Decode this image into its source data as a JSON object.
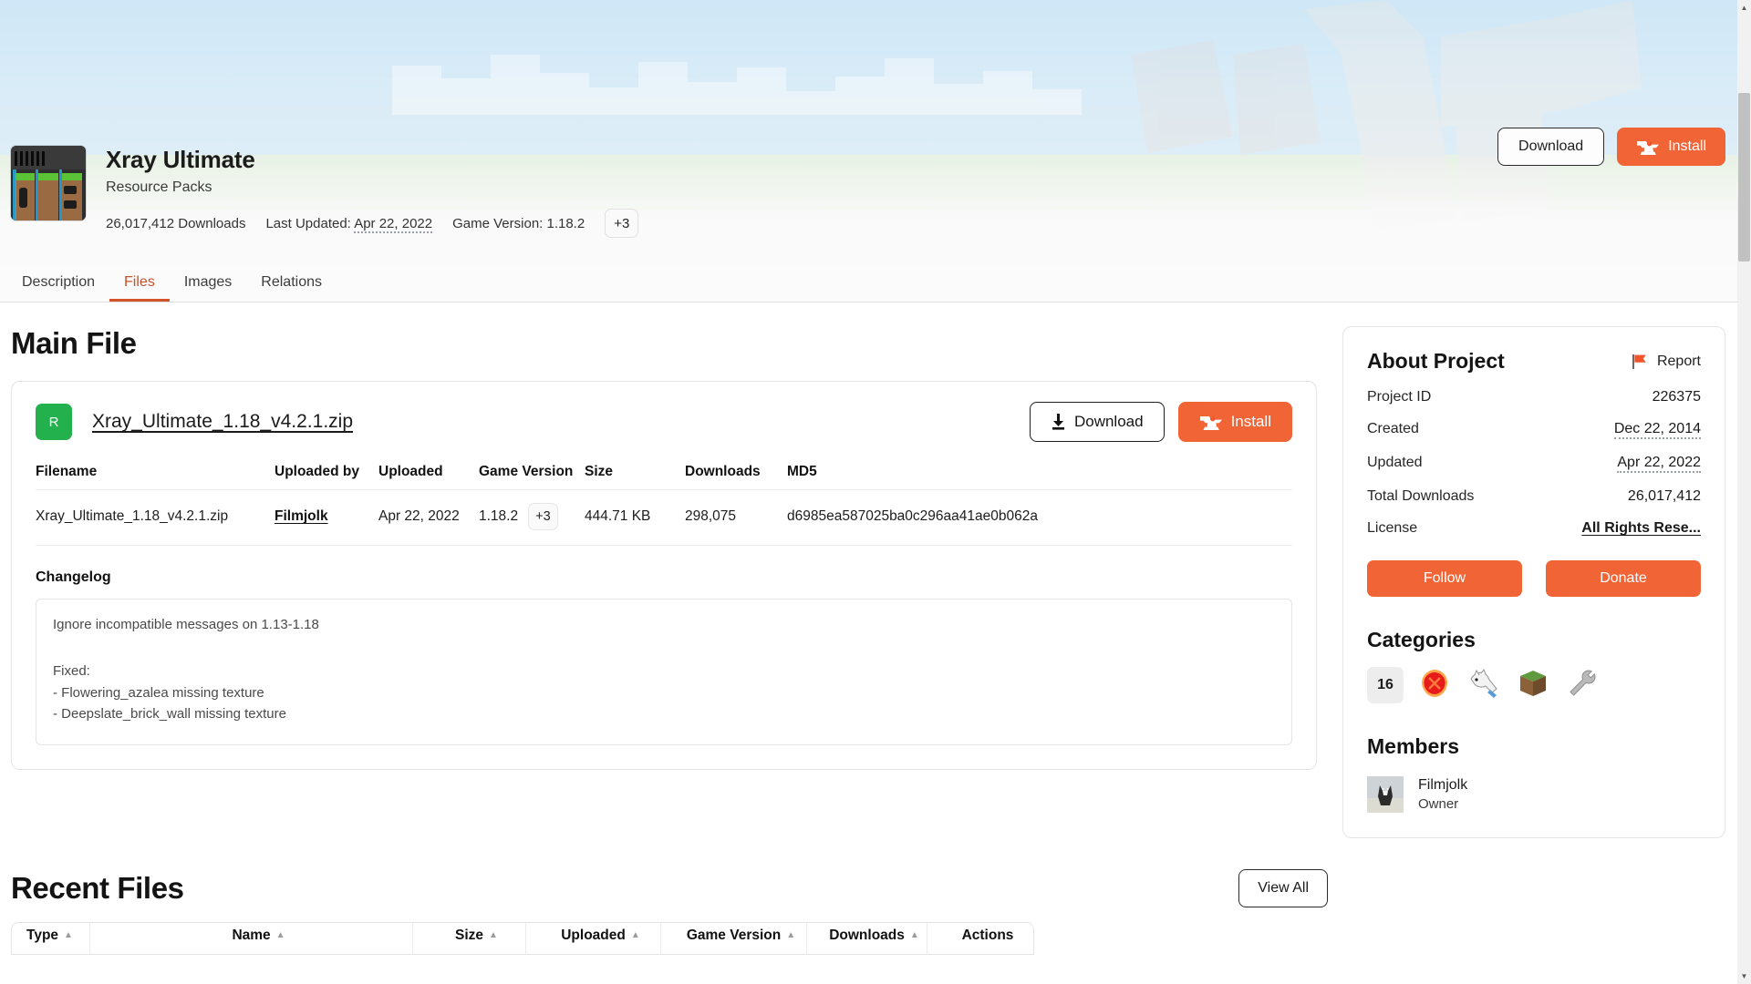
{
  "colors": {
    "accent": "#f16436",
    "tab_active": "#c7522a",
    "release_badge": "#22b14c"
  },
  "hero": {
    "project_title": "Xray Ultimate",
    "project_category": "Resource Packs",
    "downloads": "26,017,412 Downloads",
    "last_updated": "Last Updated:",
    "last_updated_value": "Apr 22, 2022",
    "game_version": "Game Version: 1.18.2",
    "more_versions_badge": "+3",
    "download_button": "Download",
    "install_button": "Install",
    "icon_name": "project-icon"
  },
  "tabs": [
    {
      "label": "Description",
      "active": false
    },
    {
      "label": "Files",
      "active": true
    },
    {
      "label": "Images",
      "active": false
    },
    {
      "label": "Relations",
      "active": false
    }
  ],
  "main": {
    "heading": "Main File",
    "file_card": {
      "release_badge": "R",
      "filename_link": "Xray_Ultimate_1.18_v4.2.1.zip",
      "download_button": "Download",
      "install_button": "Install",
      "table": {
        "headers": [
          "Filename",
          "Uploaded by",
          "Uploaded",
          "Game Version",
          "Size",
          "Downloads",
          "MD5"
        ],
        "row": {
          "filename": "Xray_Ultimate_1.18_v4.2.1.zip",
          "uploaded_by": "Filmjolk",
          "uploaded": "Apr 22, 2022",
          "game_version": "1.18.2",
          "game_version_extra": "+3",
          "size": "444.71 KB",
          "downloads": "298,075",
          "md5": "d6985ea587025ba0c296aa41ae0b062a"
        }
      },
      "changelog_label": "Changelog",
      "changelog_lines": [
        "Ignore incompatible messages on 1.13-1.18",
        "",
        "Fixed:",
        "- Flowering_azalea missing texture",
        "- Deepslate_brick_wall missing texture"
      ]
    }
  },
  "sidebar": {
    "about": {
      "title": "About Project",
      "report_label": "Report",
      "rows": [
        {
          "key": "Project ID",
          "value": "226375",
          "link": false,
          "dotted": false
        },
        {
          "key": "Created",
          "value": "Dec 22, 2014",
          "link": false,
          "dotted": true
        },
        {
          "key": "Updated",
          "value": "Apr 22, 2022",
          "link": false,
          "dotted": true
        },
        {
          "key": "Total Downloads",
          "value": "26,017,412",
          "link": false,
          "dotted": false
        },
        {
          "key": "License",
          "value": "All Rights Rese...",
          "link": true,
          "dotted": false
        }
      ],
      "follow_button": "Follow",
      "donate_button": "Donate"
    },
    "categories": {
      "title": "Categories",
      "items": [
        {
          "name": "resolution-16x-icon",
          "label": "16"
        },
        {
          "name": "redstone-icon",
          "label": ""
        },
        {
          "name": "mob-icon",
          "label": ""
        },
        {
          "name": "grass-block-icon",
          "label": ""
        },
        {
          "name": "tools-icon",
          "label": ""
        }
      ]
    },
    "members": {
      "title": "Members",
      "list": [
        {
          "name": "Filmjolk",
          "role": "Owner"
        }
      ]
    }
  },
  "recent": {
    "heading": "Recent Files",
    "view_all_button": "View All",
    "headers": [
      "Type",
      "Name",
      "Size",
      "Uploaded",
      "Game Version",
      "Downloads",
      "Actions"
    ]
  },
  "scrollbar": {
    "up_arrow": "▲",
    "down_arrow": "▼"
  }
}
